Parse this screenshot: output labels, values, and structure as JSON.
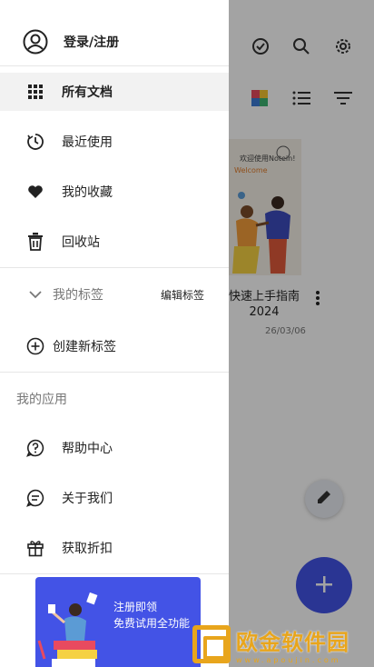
{
  "background": {
    "toolbar": {
      "check_icon": "check-circle-icon",
      "search_icon": "search-icon",
      "settings_icon": "gear-icon"
    },
    "view_icons": [
      "color-grid-icon",
      "list-icon",
      "filter-icon"
    ],
    "document": {
      "cover_line1": "欢迎使用Notein!",
      "cover_line2": "Welcome",
      "title": "快速上手指南 2024",
      "date": "26/03/06"
    },
    "fab_edit_icon": "pencil-icon",
    "fab_add_icon": "plus-icon",
    "watermark": {
      "main": "欧金软件园",
      "sub": "www.apoujin.com"
    }
  },
  "drawer": {
    "account": {
      "label": "登录/注册",
      "icon": "user-circle-icon"
    },
    "nav": [
      {
        "label": "所有文档",
        "icon": "grid-icon"
      },
      {
        "label": "最近使用",
        "icon": "clock-icon"
      },
      {
        "label": "我的收藏",
        "icon": "heart-icon"
      },
      {
        "label": "回收站",
        "icon": "trash-icon"
      }
    ],
    "tags": {
      "label": "我的标签",
      "edit_label": "编辑标签",
      "create_label": "创建新标签"
    },
    "apps": {
      "title": "我的应用",
      "items": [
        {
          "label": "帮助中心",
          "icon": "help-bubble-icon"
        },
        {
          "label": "关于我们",
          "icon": "chat-bubble-icon"
        },
        {
          "label": "获取折扣",
          "icon": "gift-icon"
        }
      ]
    },
    "banner": {
      "line1": "注册即领",
      "line2": "免费试用全功能"
    }
  },
  "colors": {
    "accent": "#4353e6",
    "watermark": "#e8a51c"
  }
}
